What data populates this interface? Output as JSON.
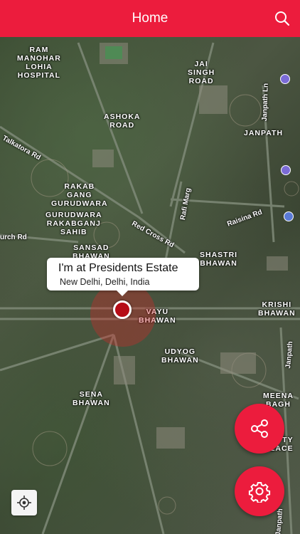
{
  "header": {
    "title": "Home",
    "search_icon": "search-icon",
    "color": "#ec1c3d"
  },
  "map": {
    "place_labels": [
      "RAM\nMANOHAR\nLOHIA\nHOSPITAL",
      "JAI\nSINGH\nROAD",
      "ASHOKA\nROAD",
      "JANPATH",
      "RAKAB\nGANG\nGURUDWARA",
      "GURUDWARA\nRAKABGANJ\nSAHIB",
      "SANSAD\nBHAWAN",
      "SHASTRI\nBHAWAN",
      "KRISHI\nBHAWAN",
      "VAYU\nBHAWAN",
      "UDYOG\nBHAWAN",
      "SENA\nBHAWAN",
      "MEENA\nBAGH",
      "TY\nPLACE"
    ],
    "road_labels": [
      "Talkatora Rd",
      "Janpath Ln",
      "Rafi Marg",
      "Red Cross Rd",
      "Raisina Rd",
      "urch Rd",
      "Janpath",
      "Janpath"
    ]
  },
  "callout": {
    "title": "I'm at Presidents Estate",
    "subtitle": "New Delhi, Delhi, India"
  },
  "marker": {
    "color": "#b60c16"
  },
  "actions": {
    "share_icon": "share-icon",
    "settings_icon": "gear-icon",
    "locate_icon": "crosshair-icon"
  }
}
